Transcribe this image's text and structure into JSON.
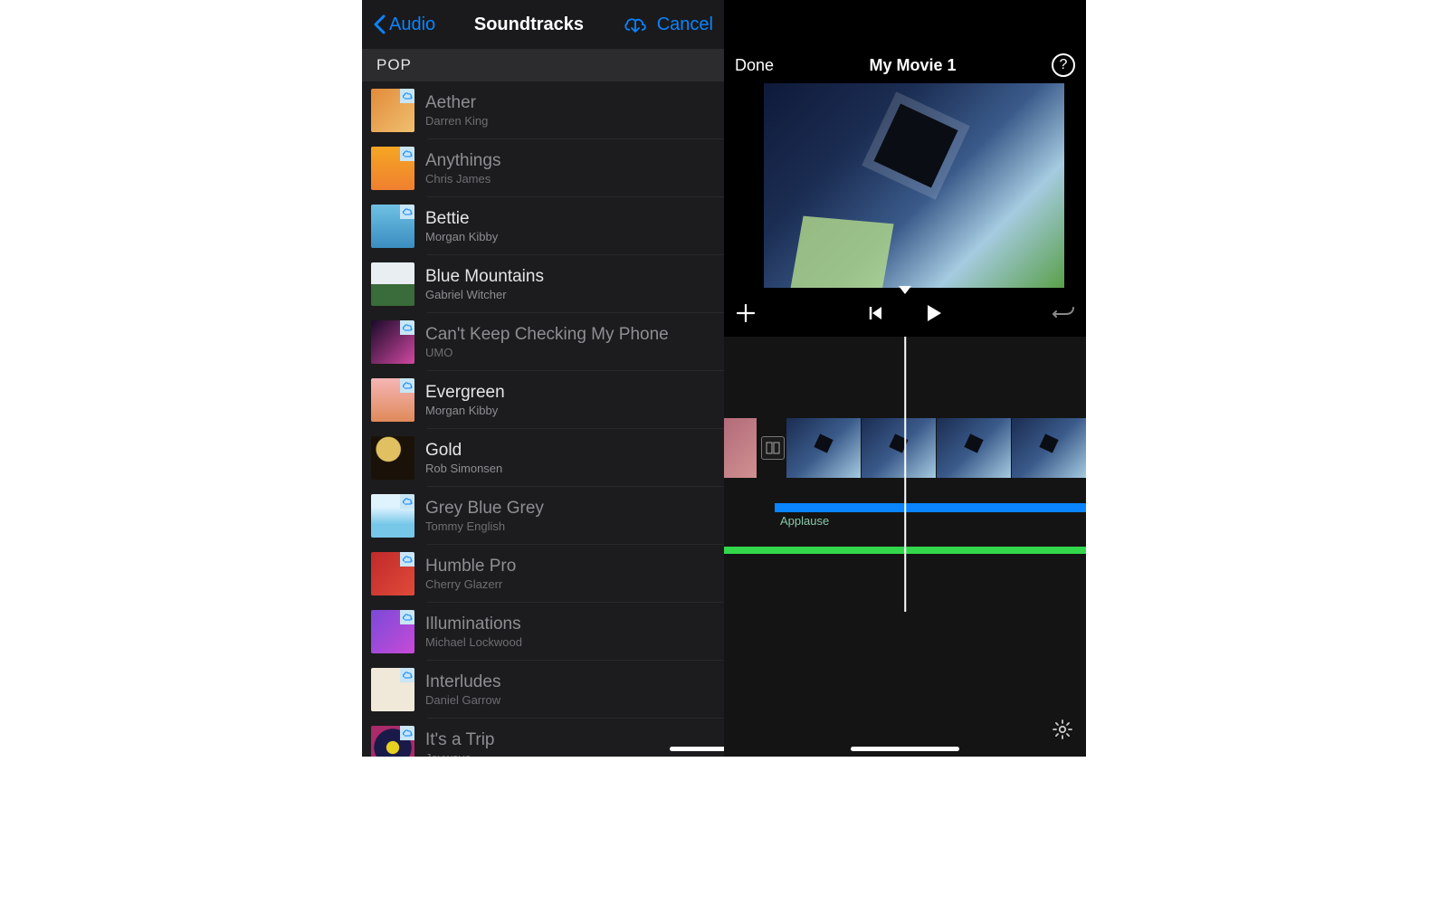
{
  "left": {
    "back_label": "Audio",
    "title": "Soundtracks",
    "cancel_label": "Cancel",
    "section": "POP",
    "tracks": [
      {
        "title": "Aether",
        "artist": "Darren King",
        "dimmed": true,
        "cloud": true
      },
      {
        "title": "Anythings",
        "artist": "Chris James",
        "dimmed": true,
        "cloud": true
      },
      {
        "title": "Bettie",
        "artist": "Morgan Kibby",
        "dimmed": false,
        "cloud": true
      },
      {
        "title": "Blue Mountains",
        "artist": "Gabriel Witcher",
        "dimmed": false,
        "cloud": false
      },
      {
        "title": "Can't Keep Checking My Phone",
        "artist": "UMO",
        "dimmed": true,
        "cloud": true
      },
      {
        "title": "Evergreen",
        "artist": "Morgan Kibby",
        "dimmed": false,
        "cloud": true
      },
      {
        "title": "Gold",
        "artist": "Rob Simonsen",
        "dimmed": false,
        "cloud": false
      },
      {
        "title": "Grey Blue Grey",
        "artist": "Tommy English",
        "dimmed": true,
        "cloud": true
      },
      {
        "title": "Humble Pro",
        "artist": "Cherry Glazerr",
        "dimmed": true,
        "cloud": true
      },
      {
        "title": "Illuminations",
        "artist": "Michael Lockwood",
        "dimmed": true,
        "cloud": true
      },
      {
        "title": "Interludes",
        "artist": "Daniel Garrow",
        "dimmed": true,
        "cloud": true
      },
      {
        "title": "It's a Trip",
        "artist": "Joywave",
        "dimmed": true,
        "cloud": true
      }
    ]
  },
  "right": {
    "done_label": "Done",
    "title": "My Movie 1",
    "help_label": "?",
    "audio_clip_label": "Applause"
  }
}
